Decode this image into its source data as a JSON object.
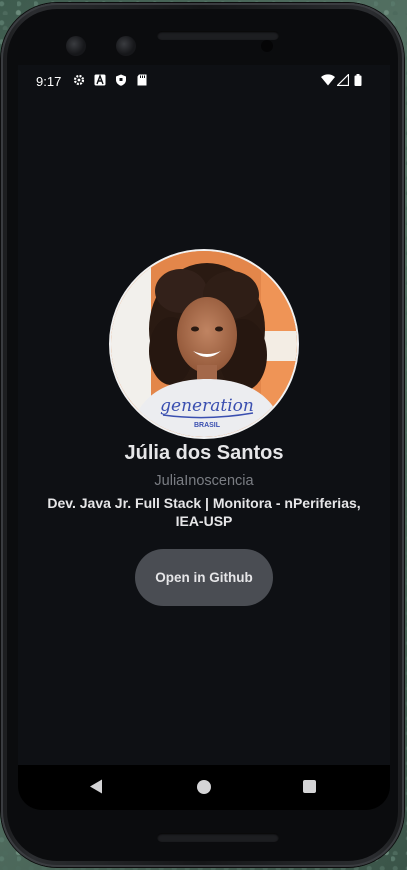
{
  "status_bar": {
    "time": "9:17",
    "left_icons": [
      "settings-icon",
      "font-a-icon",
      "shield-icon",
      "sd-card-icon"
    ],
    "right_icons": [
      "wifi-icon",
      "cell-signal-icon",
      "battery-icon"
    ]
  },
  "profile": {
    "name": "Júlia dos Santos",
    "login": "JuliaInoscencia",
    "bio": "Dev. Java Jr. Full Stack | Monitora - nPeriferias, IEA-USP",
    "avatar_shirt_text": "generation",
    "avatar_shirt_subtext": "BRASIL"
  },
  "actions": {
    "open_github_label": "Open in Github"
  },
  "nav_bar": {
    "buttons": [
      "back-icon",
      "home-icon",
      "recents-icon"
    ]
  },
  "colors": {
    "screen_bg": "#0e1014",
    "button_bg": "#4a4d53",
    "text_primary": "#e6e6e8",
    "text_secondary": "#7a7d83"
  }
}
